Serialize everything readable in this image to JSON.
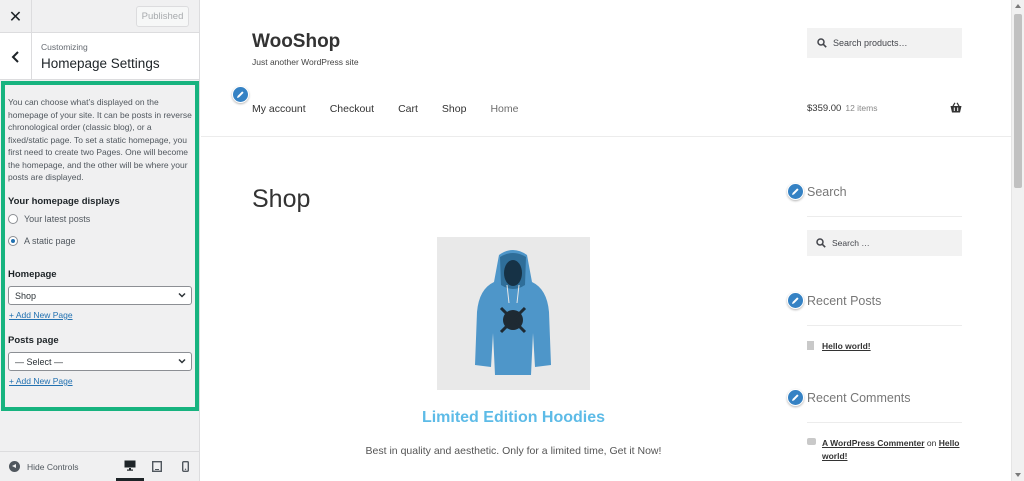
{
  "customizer": {
    "close_icon": "close-icon",
    "published_label": "Published",
    "back_icon": "chevron-left-icon",
    "breadcrumb": "Customizing",
    "section_title": "Homepage Settings",
    "description": "You can choose what’s displayed on the homepage of your site. It can be posts in reverse chronological order (classic blog), or a fixed/static page. To set a static homepage, you first need to create two Pages. One will become the homepage, and the other will be where your posts are displayed.",
    "homepage_displays": {
      "label": "Your homepage displays",
      "options": [
        "Your latest posts",
        "A static page"
      ],
      "selected": "A static page"
    },
    "homepage": {
      "label": "Homepage",
      "value": "Shop",
      "add_link": "+ Add New Page"
    },
    "posts_page": {
      "label": "Posts page",
      "value": "— Select —",
      "add_link": "+ Add New Page"
    },
    "footer": {
      "hide_controls": "Hide Controls",
      "devices": [
        "desktop-icon",
        "tablet-icon",
        "mobile-icon"
      ],
      "active_device": "desktop-icon"
    },
    "highlight_color": "#17b37f"
  },
  "site": {
    "title": "WooShop",
    "tagline": "Just another WordPress site",
    "search_placeholder": "Search products…",
    "nav": [
      "My account",
      "Checkout",
      "Cart",
      "Shop",
      "Home"
    ],
    "cart": {
      "total": "$359.00",
      "items": "12 items",
      "icon": "basket-icon"
    },
    "page_title": "Shop",
    "product": {
      "title": "Limited Edition Hoodies",
      "description": "Best in quality and aesthetic. Only for a limited time, Get it Now!",
      "image": "blue-hoodie-image",
      "title_color": "#5dbbe7"
    },
    "widgets": {
      "search": {
        "title": "Search",
        "placeholder": "Search …"
      },
      "recent_posts": {
        "title": "Recent Posts",
        "items": [
          "Hello world!"
        ]
      },
      "recent_comments": {
        "title": "Recent Comments",
        "author": "A WordPress Commenter",
        "on": "on",
        "post": "Hello world!"
      }
    },
    "edit_shortcut_color": "#3582c4"
  }
}
